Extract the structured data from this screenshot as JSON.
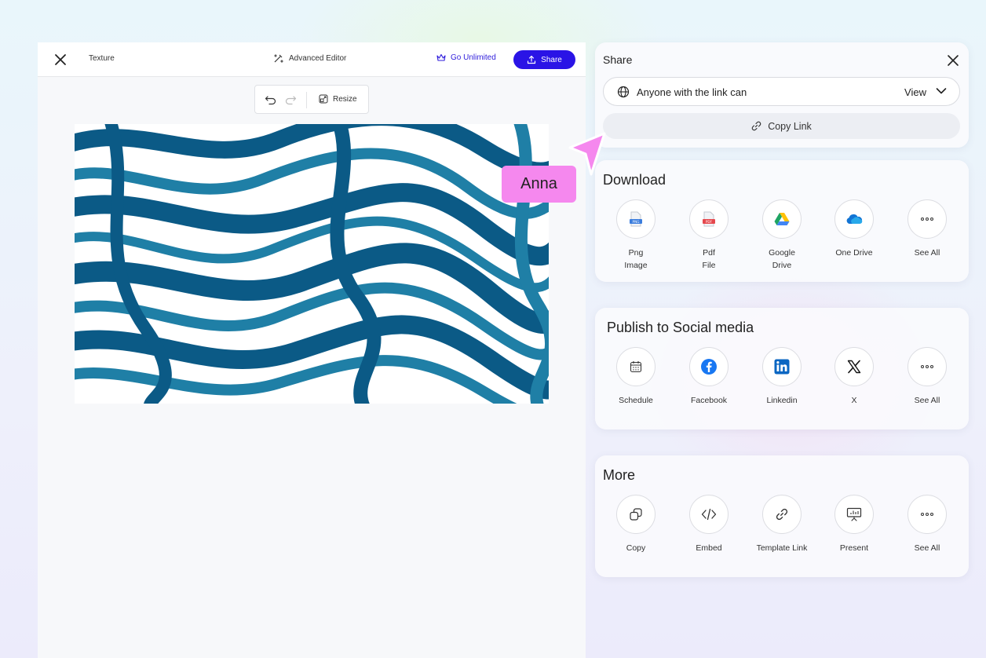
{
  "editor": {
    "title": "Texture",
    "advanced_editor": "Advanced Editor",
    "go_unlimited": "Go Unlimited",
    "share_button": "Share",
    "resize": "Resize"
  },
  "share_panel": {
    "title": "Share",
    "access_label": "Anyone with the link can",
    "access_mode": "View",
    "copy_link": "Copy Link"
  },
  "download": {
    "title": "Download",
    "items": [
      {
        "label": "Png\nImage",
        "icon": "png-file-icon"
      },
      {
        "label": "Pdf\nFile",
        "icon": "pdf-file-icon"
      },
      {
        "label": "Google\nDrive",
        "icon": "google-drive-icon"
      },
      {
        "label": "One Drive",
        "icon": "onedrive-icon"
      },
      {
        "label": "See All",
        "icon": "more-icon"
      }
    ],
    "png_badge": "PNG",
    "pdf_badge": "PDF"
  },
  "social": {
    "title": "Publish to Social media",
    "items": [
      {
        "label": "Schedule",
        "icon": "calendar-icon"
      },
      {
        "label": "Facebook",
        "icon": "facebook-icon"
      },
      {
        "label": "Linkedin",
        "icon": "linkedin-icon"
      },
      {
        "label": "X",
        "icon": "x-icon"
      },
      {
        "label": "See All",
        "icon": "more-icon"
      }
    ]
  },
  "more": {
    "title": "More",
    "items": [
      {
        "label": "Copy",
        "icon": "copy-icon"
      },
      {
        "label": "Embed",
        "icon": "embed-code-icon"
      },
      {
        "label": "Template Link",
        "icon": "link-icon"
      },
      {
        "label": "Present",
        "icon": "presentation-icon"
      },
      {
        "label": "See All",
        "icon": "more-icon"
      }
    ]
  },
  "collaborator": {
    "name": "Anna",
    "color": "#f588ee"
  },
  "colors": {
    "accent": "#2a14e6",
    "texture_dark": "#0b5a86",
    "texture_mid": "#1f7fa6"
  }
}
